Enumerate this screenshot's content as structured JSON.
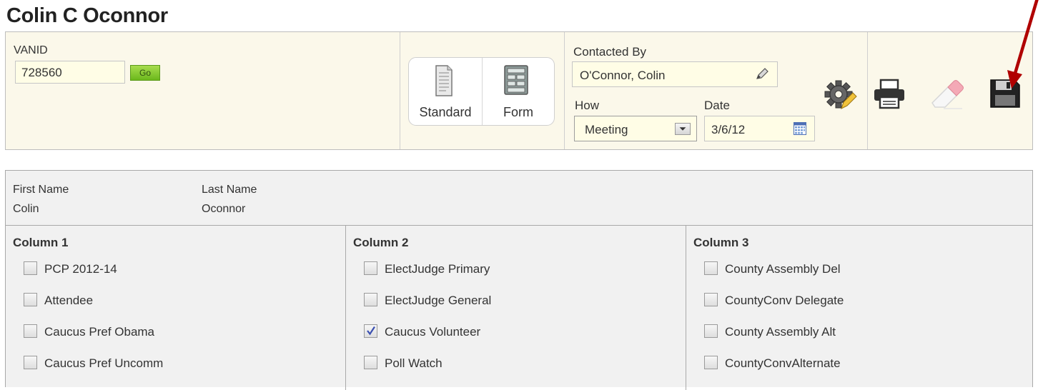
{
  "page": {
    "title": "Colin C Oconnor"
  },
  "toolbar": {
    "vanid_label": "VANID",
    "vanid_value": "728560",
    "go_label": "Go",
    "standard_label": "Standard",
    "form_label": "Form",
    "contacted_by_label": "Contacted By",
    "contacted_by_value": "O'Connor, Colin",
    "how_label": "How",
    "how_value": "Meeting",
    "date_label": "Date",
    "date_value": "3/6/12",
    "icons": [
      "gear-icon",
      "print-icon",
      "eraser-icon",
      "save-icon"
    ]
  },
  "person": {
    "first_name_label": "First Name",
    "first_name": "Colin",
    "last_name_label": "Last Name",
    "last_name": "Oconnor"
  },
  "columns": [
    {
      "header": "Column 1",
      "items": [
        {
          "label": "PCP 2012-14",
          "checked": false
        },
        {
          "label": "Attendee",
          "checked": false
        },
        {
          "label": "Caucus Pref Obama",
          "checked": false
        },
        {
          "label": "Caucus Pref Uncomm",
          "checked": false
        }
      ]
    },
    {
      "header": "Column 2",
      "items": [
        {
          "label": "ElectJudge Primary",
          "checked": false
        },
        {
          "label": "ElectJudge General",
          "checked": false
        },
        {
          "label": "Caucus Volunteer",
          "checked": true
        },
        {
          "label": "Poll Watch",
          "checked": false
        }
      ]
    },
    {
      "header": "Column 3",
      "items": [
        {
          "label": "County Assembly Del",
          "checked": false
        },
        {
          "label": "CountyConv Delegate",
          "checked": false
        },
        {
          "label": "County Assembly Alt",
          "checked": false
        },
        {
          "label": "CountyConvAlternate",
          "checked": false
        }
      ]
    }
  ],
  "colors": {
    "annotation_arrow": "#b00000",
    "go_button": "#8bcb34",
    "input_bg": "#fffde6",
    "check_mark": "#3a4fb0"
  }
}
